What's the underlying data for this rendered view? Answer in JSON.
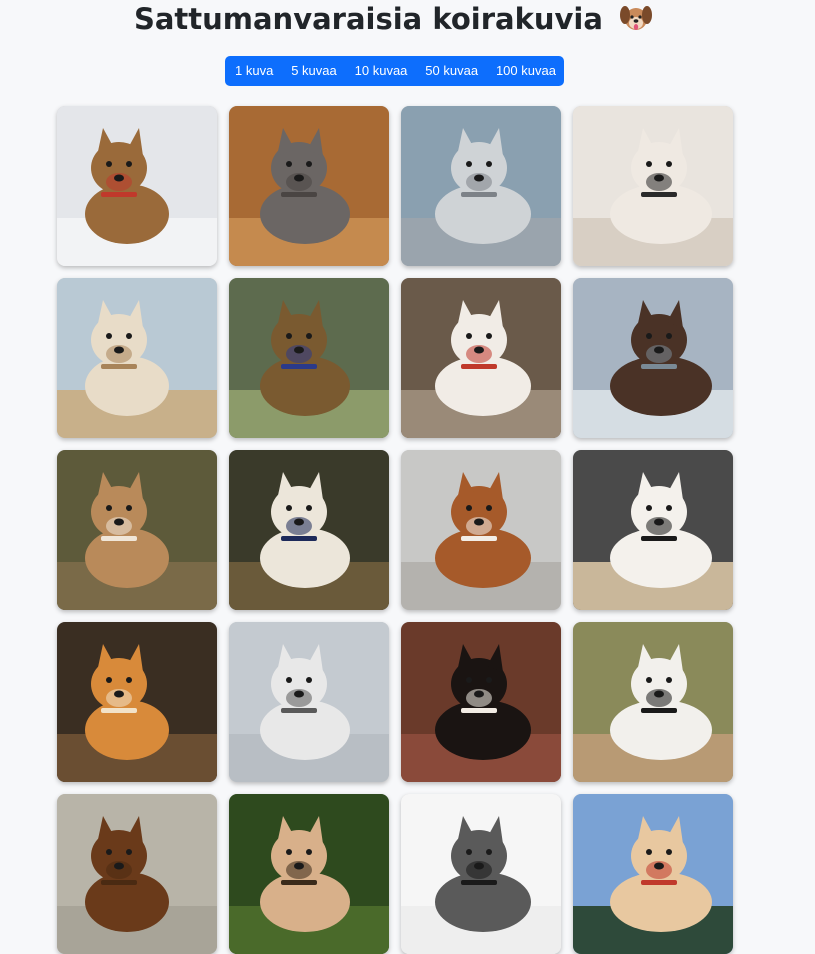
{
  "page": {
    "title": "Sattumanvaraisia koirakuvia",
    "title_emoji_icon": "dog-face-icon"
  },
  "buttons": [
    {
      "label": "1 kuva"
    },
    {
      "label": "5 kuvaa"
    },
    {
      "label": "10 kuvaa"
    },
    {
      "label": "50 kuvaa"
    },
    {
      "label": "100 kuvaa"
    }
  ],
  "colors": {
    "accent": "#0d6efd",
    "background": "#f7f8fa"
  },
  "images": [
    {
      "name": "dog-image-brown-mix-in-snow",
      "bg": "#e4e6ea",
      "dog": "#9a6a3a",
      "accent": "#c0392b",
      "ground": "#f2f3f5"
    },
    {
      "name": "dog-image-grey-poodle-on-floor",
      "bg": "#a86a34",
      "dog": "#6b6664",
      "accent": "#4a4543",
      "ground": "#c58a4e"
    },
    {
      "name": "dog-image-husky-closeup",
      "bg": "#8aa0b0",
      "dog": "#cfd3d6",
      "accent": "#7d8288",
      "ground": "#9aa4ad"
    },
    {
      "name": "dog-image-white-fluffy-dog",
      "bg": "#e9e4de",
      "dog": "#efe9e2",
      "accent": "#2a2a2a",
      "ground": "#d8cfc4"
    },
    {
      "name": "dog-image-white-dog-standing",
      "bg": "#b9c9d4",
      "dog": "#e8dcc8",
      "accent": "#a8845a",
      "ground": "#c8b08a"
    },
    {
      "name": "dog-image-malinois-in-grass",
      "bg": "#5d6b4e",
      "dog": "#7a5a30",
      "accent": "#2b3a8a",
      "ground": "#8c9b6a"
    },
    {
      "name": "dog-image-corgi-tricolor",
      "bg": "#6a5a4a",
      "dog": "#f1ece6",
      "accent": "#c0392b",
      "ground": "#9a8a78"
    },
    {
      "name": "dog-image-dog-by-lake",
      "bg": "#a7b4c2",
      "dog": "#4a3226",
      "accent": "#7a8a96",
      "ground": "#d5dde3"
    },
    {
      "name": "dog-image-beagle-outdoors",
      "bg": "#5d5a3a",
      "dog": "#b98a5a",
      "accent": "#f0e6d8",
      "ground": "#7a6a48"
    },
    {
      "name": "dog-image-white-dog-with-bandana",
      "bg": "#3a3a2a",
      "dog": "#ece6da",
      "accent": "#1d2a5a",
      "ground": "#6a5a3a"
    },
    {
      "name": "dog-image-saint-bernard-puppy",
      "bg": "#c8c8c6",
      "dog": "#a65a2a",
      "accent": "#f2ede6",
      "ground": "#b4b2ae"
    },
    {
      "name": "dog-image-white-dog-lying",
      "bg": "#4a4a4a",
      "dog": "#f4f1ec",
      "accent": "#1a1a1a",
      "ground": "#c9b79a"
    },
    {
      "name": "dog-image-shiba-inu",
      "bg": "#3a2e22",
      "dog": "#d88a3a",
      "accent": "#f2e2c8",
      "ground": "#6a4e32"
    },
    {
      "name": "dog-image-malamute-closeup",
      "bg": "#c4cad0",
      "dog": "#e8e8e8",
      "accent": "#5a5a5a",
      "ground": "#b8bec4"
    },
    {
      "name": "dog-image-swiss-mountain-dog",
      "bg": "#6a3a2a",
      "dog": "#1a1412",
      "accent": "#f2ece4",
      "ground": "#8a4a3a"
    },
    {
      "name": "dog-image-french-bulldog-sitting",
      "bg": "#8a8a5a",
      "dog": "#f2f0ec",
      "accent": "#1a1a1a",
      "ground": "#b89a74"
    },
    {
      "name": "dog-image-cocker-spaniel",
      "bg": "#b8b4a8",
      "dog": "#6a3a1a",
      "accent": "#4a2a12",
      "ground": "#a8a498"
    },
    {
      "name": "dog-image-pharaoh-hound",
      "bg": "#2e4a1e",
      "dog": "#d8b08a",
      "accent": "#3a2a1a",
      "ground": "#4a6a2a"
    },
    {
      "name": "dog-image-keeshond",
      "bg": "#f6f6f6",
      "dog": "#5a5a5a",
      "accent": "#1a1a1a",
      "ground": "#eeeeee"
    },
    {
      "name": "dog-image-akita-in-snow",
      "bg": "#7aa2d4",
      "dog": "#e8c8a0",
      "accent": "#c0392b",
      "ground": "#2e4a3a"
    }
  ]
}
